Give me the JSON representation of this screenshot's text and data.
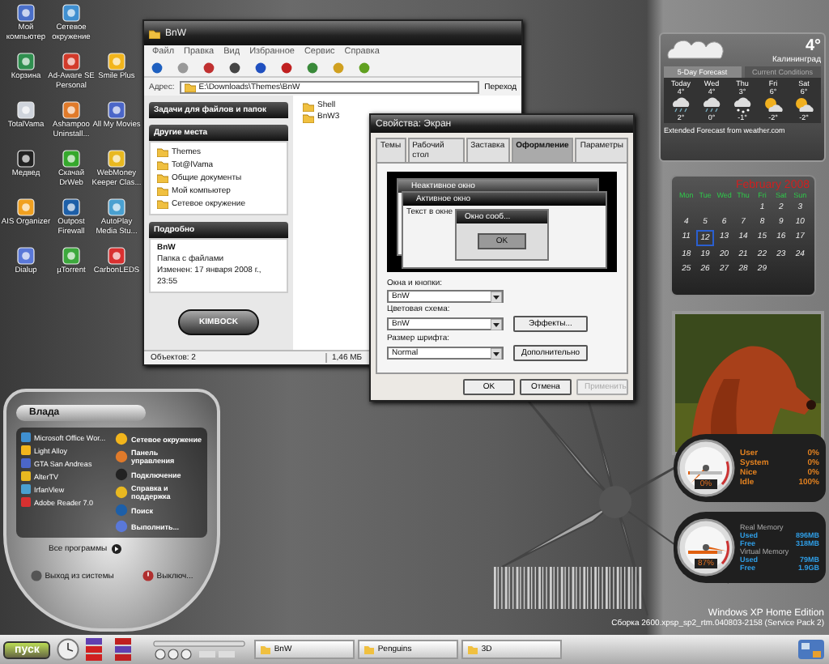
{
  "desktop_icons": [
    [
      {
        "label": "Мой компьютер"
      },
      {
        "label": "Сетевое окружение"
      }
    ],
    [
      {
        "label": "Корзина"
      },
      {
        "label": "Ad-Aware SE Personal"
      },
      {
        "label": "Smile Plus"
      }
    ],
    [
      {
        "label": "TotalVama"
      },
      {
        "label": "Ashampoo Uninstall..."
      },
      {
        "label": "All My Movies"
      }
    ],
    [
      {
        "label": "Медвед"
      },
      {
        "label": "Скачай DrWeb"
      },
      {
        "label": "WebMoney Keeper Clas..."
      }
    ],
    [
      {
        "label": "AIS Organizer"
      },
      {
        "label": "Outpost Firewall"
      },
      {
        "label": "AutoPlay Media Stu..."
      }
    ],
    [
      {
        "label": "Dialup"
      },
      {
        "label": "µTorrent"
      },
      {
        "label": "CarbonLEDS"
      }
    ]
  ],
  "explorer": {
    "title": "BnW",
    "menu": [
      "Файл",
      "Правка",
      "Вид",
      "Избранное",
      "Сервис",
      "Справка"
    ],
    "address_label": "Адрес:",
    "address": "E:\\Downloads\\Themes\\BnW",
    "go_button": "Переход",
    "panels": [
      {
        "title": "Задачи для файлов и папок"
      },
      {
        "title": "Другие места",
        "links": [
          "Themes",
          "Tot@lVama",
          "Общие документы",
          "Мой компьютер",
          "Сетевое окружение"
        ]
      },
      {
        "title": "Подробно",
        "lines": [
          "BnW",
          "Папка с файлами",
          "Изменен: 17 января 2008 г., 23:55"
        ]
      }
    ],
    "logo": "KIMBOCK",
    "files": [
      "Shell",
      "BnW3"
    ],
    "status": [
      "Объектов: 2",
      "1,46 МБ"
    ]
  },
  "display_properties": {
    "title": "Свойства: Экран",
    "tabs": [
      {
        "label": "Темы",
        "selected": false
      },
      {
        "label": "Рабочий стол",
        "selected": false
      },
      {
        "label": "Заставка",
        "selected": false
      },
      {
        "label": "Оформление",
        "selected": true
      },
      {
        "label": "Параметры",
        "selected": false
      }
    ],
    "preview": {
      "inactive_title": "Неактивное окно",
      "active_title": "Активное окно",
      "window_text": "Текст в окне",
      "message_title": "Окно сооб...",
      "ok": "OK"
    },
    "fields": [
      {
        "label": "Окна и кнопки:",
        "value": "BnW"
      },
      {
        "label": "Цветовая схема:",
        "value": "BnW"
      },
      {
        "label": "Размер шрифта:",
        "value": "Normal"
      }
    ],
    "side_buttons": [
      "Эффекты...",
      "Дополнительно"
    ],
    "buttons": [
      {
        "label": "OK",
        "disabled": false
      },
      {
        "label": "Отмена",
        "disabled": false
      },
      {
        "label": "Применить",
        "disabled": true
      }
    ]
  },
  "weather": {
    "temperature": "4°",
    "city": "Калининград",
    "tabs": [
      {
        "label": "5-Day Forecast",
        "selected": true
      },
      {
        "label": "Current Conditions",
        "selected": false
      }
    ],
    "days": [
      {
        "name": "Today",
        "high": "4°",
        "low": "2°",
        "kind": "rain"
      },
      {
        "name": "Wed",
        "high": "4°",
        "low": "0°",
        "kind": "rain"
      },
      {
        "name": "Thu",
        "high": "3°",
        "low": "-1°",
        "kind": "snow"
      },
      {
        "name": "Fri",
        "high": "6°",
        "low": "-2°",
        "kind": "sun"
      },
      {
        "name": "Sat",
        "high": "6°",
        "low": "-2°",
        "kind": "sun"
      }
    ],
    "footer": "Extended Forecast from weather.com"
  },
  "calendar": {
    "title": "February 2008",
    "weekdays": [
      "Mon",
      "Tue",
      "Wed",
      "Thu",
      "Fri",
      "Sat",
      "Sun"
    ],
    "weeks": [
      [
        {
          "day": "1",
          "selected": false
        },
        {
          "day": "2",
          "selected": false
        },
        {
          "day": "3",
          "selected": false
        }
      ],
      [
        {
          "day": "4",
          "selected": false
        },
        {
          "day": "5",
          "selected": false
        },
        {
          "day": "6",
          "selected": false
        },
        {
          "day": "7",
          "selected": false
        },
        {
          "day": "8",
          "selected": false
        },
        {
          "day": "9",
          "selected": false
        },
        {
          "day": "10",
          "selected": false
        }
      ],
      [
        {
          "day": "11",
          "selected": false
        },
        {
          "day": "12",
          "selected": true
        },
        {
          "day": "13",
          "selected": false
        },
        {
          "day": "14",
          "selected": false
        },
        {
          "day": "15",
          "selected": false
        },
        {
          "day": "16",
          "selected": false
        },
        {
          "day": "17",
          "selected": false
        }
      ],
      [
        {
          "day": "18",
          "selected": false
        },
        {
          "day": "19",
          "selected": false
        },
        {
          "day": "20",
          "selected": false
        },
        {
          "day": "21",
          "selected": false
        },
        {
          "day": "22",
          "selected": false
        },
        {
          "day": "23",
          "selected": false
        },
        {
          "day": "24",
          "selected": false
        }
      ],
      [
        {
          "day": "25",
          "selected": false
        },
        {
          "day": "26",
          "selected": false
        },
        {
          "day": "27",
          "selected": false
        },
        {
          "day": "28",
          "selected": false
        },
        {
          "day": "29",
          "selected": false
        }
      ]
    ]
  },
  "cpu_monitor": {
    "reading": "0%",
    "level": 0,
    "stats": [
      {
        "label": "User",
        "value": "0%"
      },
      {
        "label": "System",
        "value": "0%"
      },
      {
        "label": "Nice",
        "value": "0%"
      },
      {
        "label": "Idle",
        "value": "100%"
      }
    ]
  },
  "memory_monitor": {
    "reading": "87%",
    "level": 0.87,
    "groups": [
      {
        "title": "Real Memory",
        "stats": [
          {
            "label": "Used",
            "value": "896MB"
          },
          {
            "label": "Free",
            "value": "318MB"
          }
        ]
      },
      {
        "title": "Virtual Memory",
        "stats": [
          {
            "label": "Used",
            "value": "79MB"
          },
          {
            "label": "Free",
            "value": "1.9GB"
          }
        ]
      }
    ]
  },
  "os_version": [
    "Windows XP Home Edition",
    "Сборка 2600.xpsp_sp2_rtm.040803-2158 (Service Pack 2)"
  ],
  "start_menu": {
    "user": "Влада",
    "programs": [
      "Microsoft Office Wor...",
      "Light Alloy",
      "GTA San Andreas",
      "AlterTV",
      "IrfanView",
      "Adobe Reader 7.0"
    ],
    "places": [
      "Сетевое окружение",
      "Панель управления",
      "Подключение",
      "Справка и поддержка",
      "Поиск",
      "Выполнить..."
    ],
    "all_programs": "Все программы",
    "logoff": "Выход из системы",
    "shutdown": "Выключ..."
  },
  "taskbar": {
    "start": "пуск",
    "tasks": [
      {
        "label": "BnW",
        "selected": false
      },
      {
        "label": "Penguins",
        "selected": false
      },
      {
        "label": "3D",
        "selected": false
      }
    ]
  }
}
